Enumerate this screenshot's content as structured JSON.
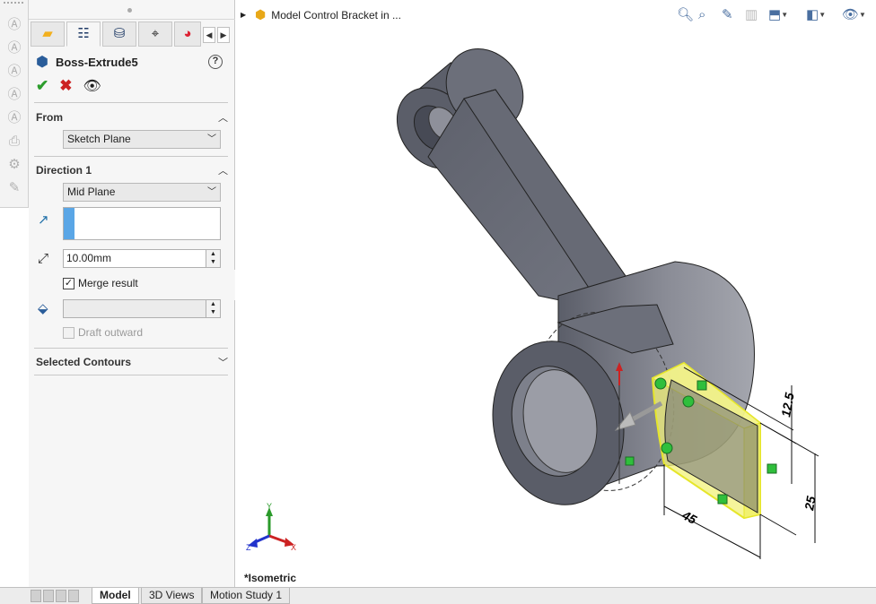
{
  "left_toolbar": {
    "icons": [
      "text-a-icon",
      "text-a-icon",
      "text-a-icon",
      "text-a-icon",
      "text-a-icon",
      "print-icon",
      "gear-icon",
      "wrench-icon"
    ]
  },
  "manager_tabs": [
    {
      "name": "feature-manager-tab",
      "icon": "▰",
      "color": "#f2b01e"
    },
    {
      "name": "property-manager-tab",
      "icon": "☷",
      "color": "#1f3a66"
    },
    {
      "name": "configuration-manager-tab",
      "icon": "⛁",
      "color": "#1f3a66"
    },
    {
      "name": "dimxpert-manager-tab",
      "icon": "⌖",
      "color": "#222"
    },
    {
      "name": "display-manager-tab",
      "icon": "◕",
      "color": "#d23"
    }
  ],
  "feature": {
    "title": "Boss-Extrude5",
    "help": "?"
  },
  "from": {
    "label": "From",
    "value": "Sketch Plane"
  },
  "direction1": {
    "label": "Direction 1",
    "end_condition": "Mid Plane",
    "depth": "10.00mm",
    "merge_result": "Merge result",
    "draft_outward": "Draft outward"
  },
  "selected_contours": {
    "label": "Selected Contours"
  },
  "viewport": {
    "document_title": "Model Control Bracket in ...",
    "view_name": "*Isometric",
    "triad": {
      "x": "X",
      "y": "Y",
      "z": "Z"
    },
    "dimensions": [
      "12.5",
      "25",
      "45"
    ],
    "colors": {
      "body": "#6a6d78",
      "body_light": "#9a9ca6",
      "face_dark": "#5b5e69",
      "preview": "#f2f27a",
      "preview_edge": "#e6e62a",
      "handle": "#2fbf3c"
    }
  },
  "bottom_tabs": [
    {
      "label": "Model",
      "active": true
    },
    {
      "label": "3D Views",
      "active": false
    },
    {
      "label": "Motion Study 1",
      "active": false
    }
  ]
}
